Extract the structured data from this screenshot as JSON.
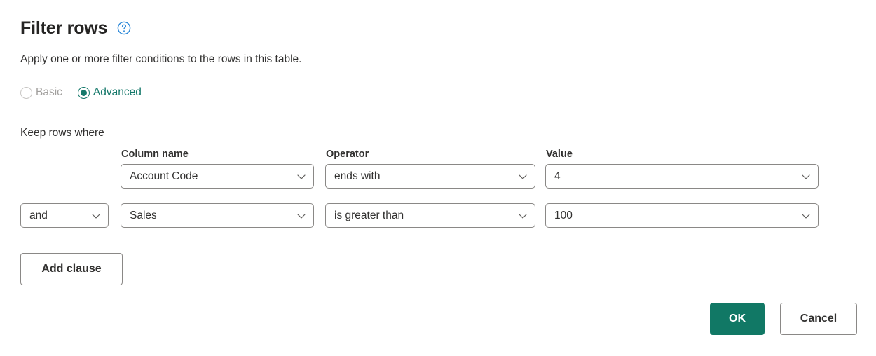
{
  "dialog": {
    "title": "Filter rows",
    "help_icon": "help-circle-icon",
    "subtitle": "Apply one or more filter conditions to the rows in this table.",
    "keep_rows_label": "Keep rows where"
  },
  "mode": {
    "options": [
      {
        "label": "Basic",
        "selected": false,
        "disabled": true
      },
      {
        "label": "Advanced",
        "selected": true,
        "disabled": false
      }
    ],
    "selected_value": "Advanced"
  },
  "columns": {
    "column_name": "Column name",
    "operator": "Operator",
    "value": "Value"
  },
  "clauses": [
    {
      "conjunction": null,
      "column_name": "Account Code",
      "operator": "ends with",
      "value": "4"
    },
    {
      "conjunction": "and",
      "column_name": "Sales",
      "operator": "is greater than",
      "value": "100"
    }
  ],
  "buttons": {
    "add_clause": "Add clause",
    "ok": "OK",
    "cancel": "Cancel"
  },
  "colors": {
    "accent_teal": "#117865",
    "radio_selected": "#14786a",
    "help_blue": "#2b88d8",
    "disabled_text": "#a19f9d",
    "border": "#8a8886",
    "text": "#323130"
  }
}
